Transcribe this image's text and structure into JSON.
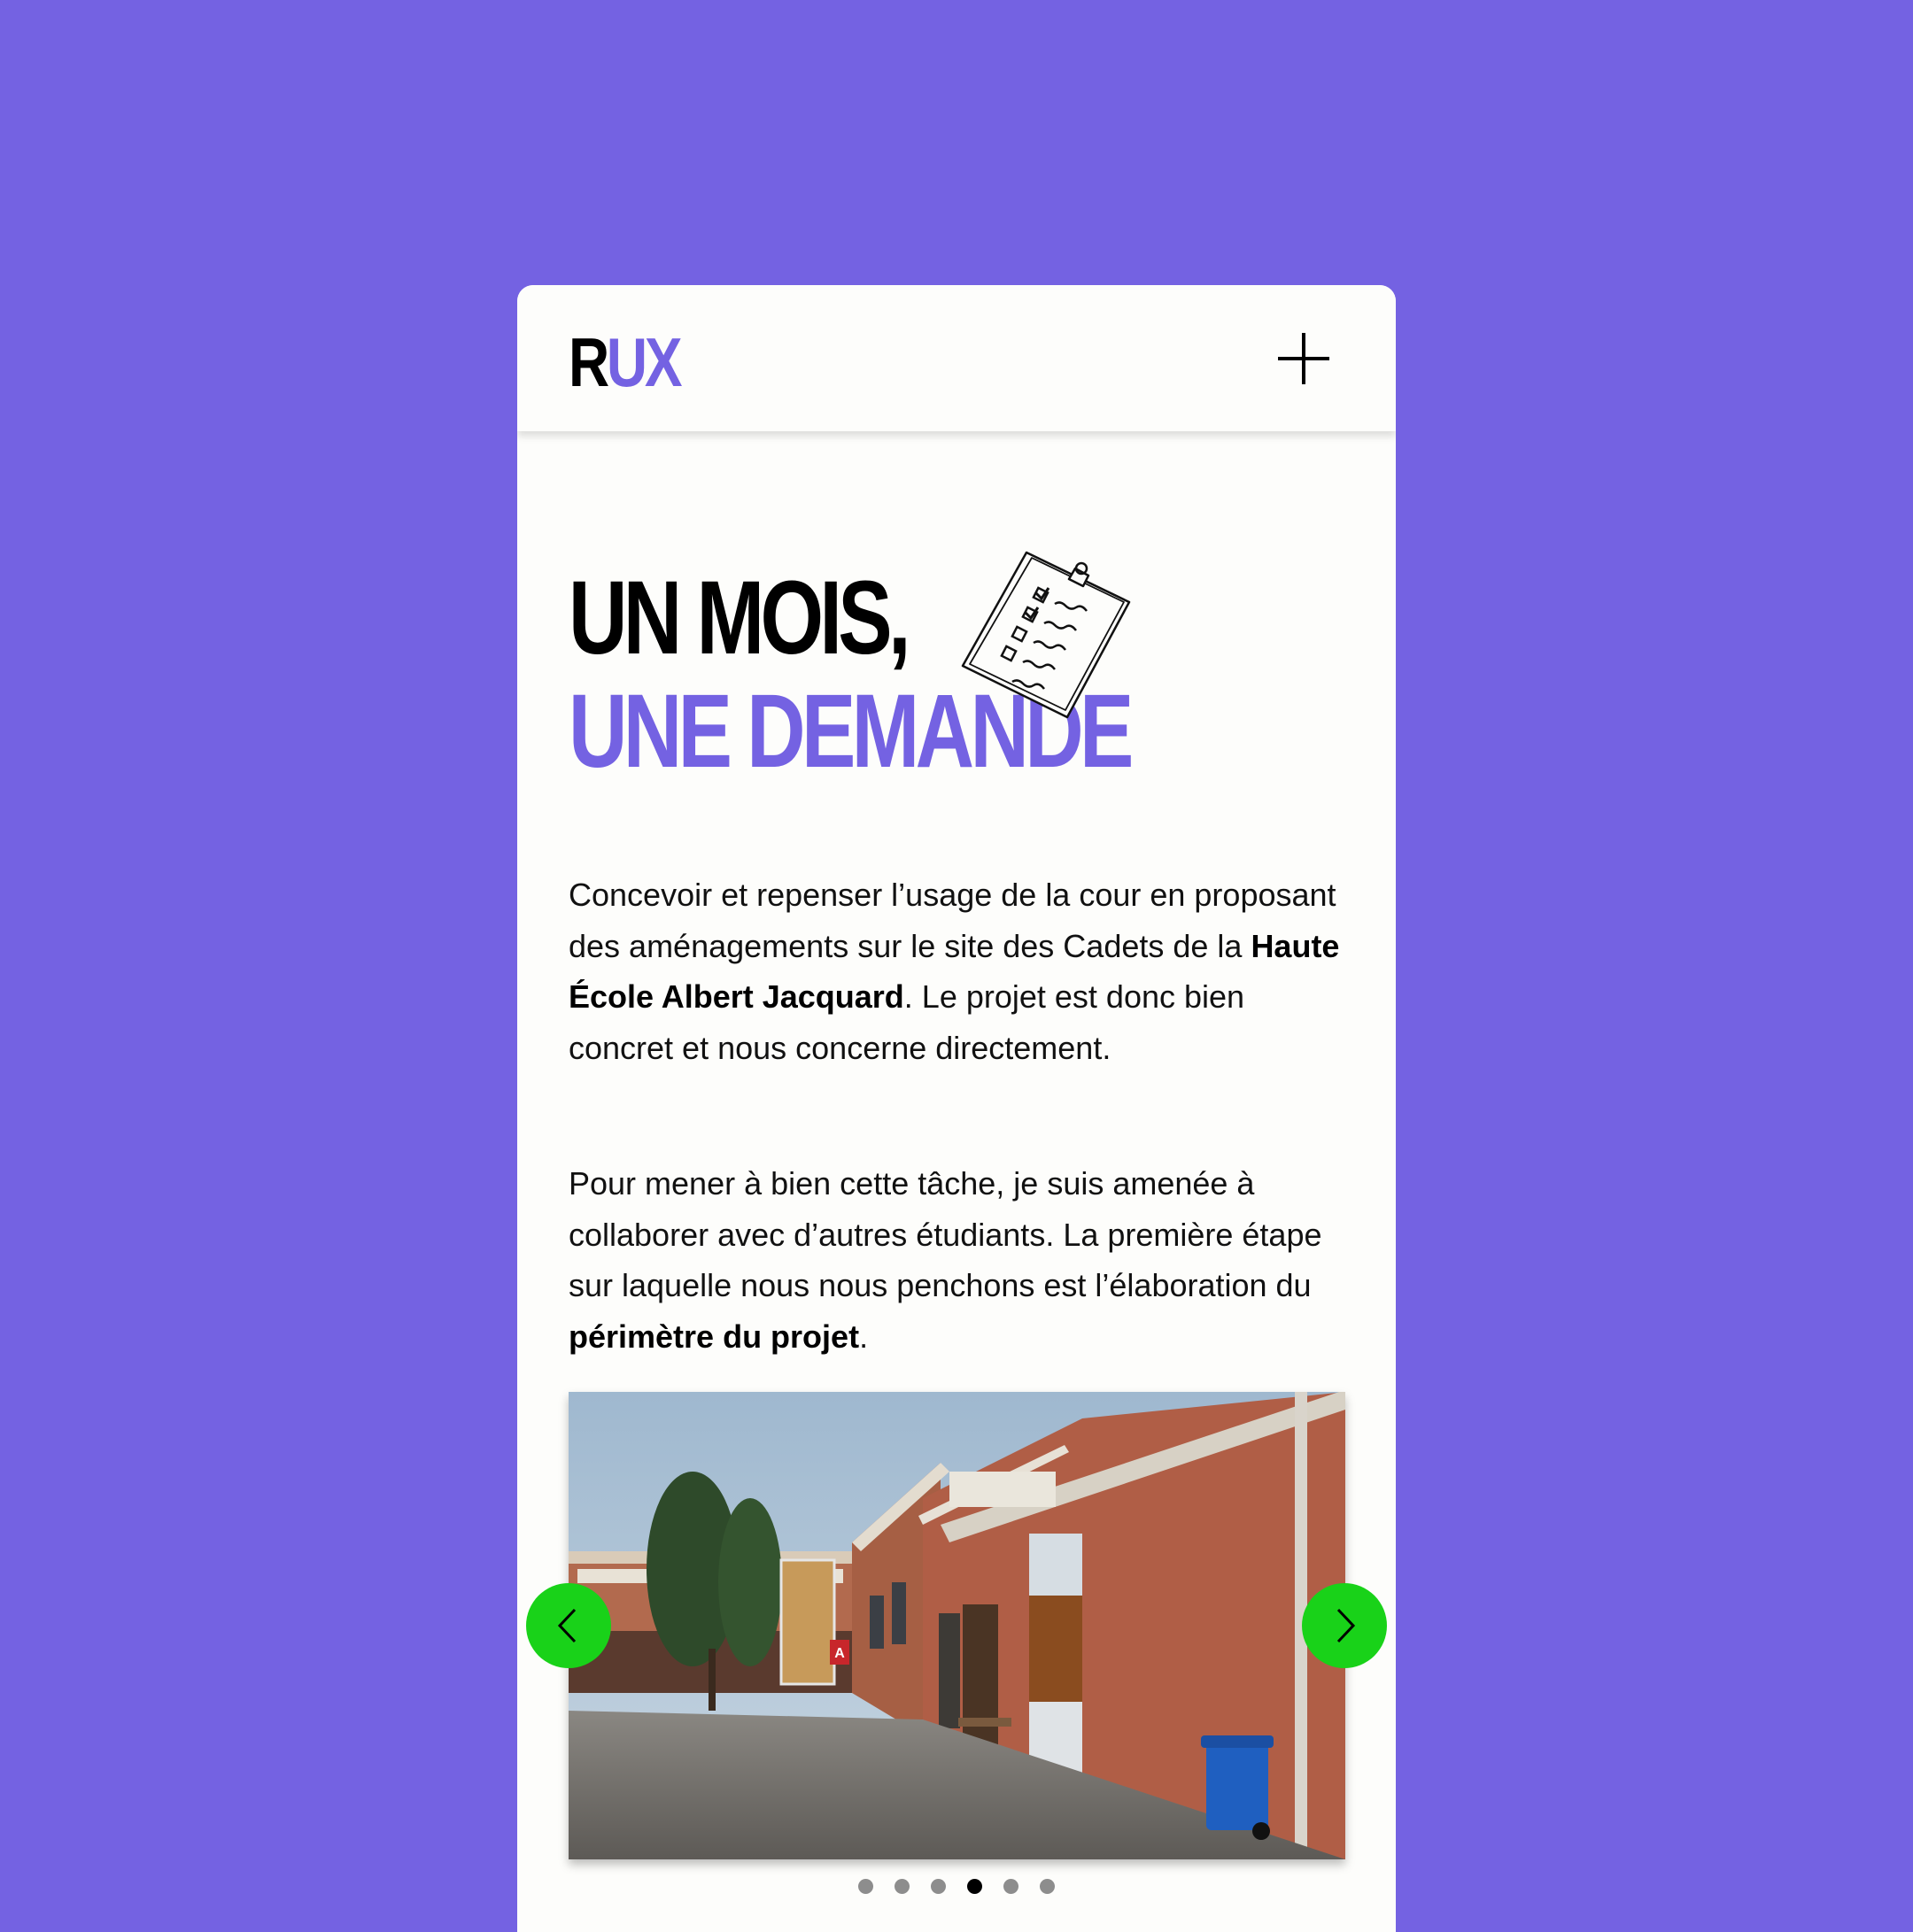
{
  "colors": {
    "background": "#7462e2",
    "accent": "#7462e2",
    "card": "#fdfdfb",
    "nav_button": "#19d219",
    "text": "#111111"
  },
  "header": {
    "logo_part1": "R",
    "logo_part2": "UX",
    "menu_icon": "plus-icon"
  },
  "hero": {
    "title_line1": "UN MOIS,",
    "title_line2": "UNE DEMANDE",
    "illustration": "clipboard-checklist-icon"
  },
  "paragraph1": {
    "text_before": "Concevoir et repenser l’usage de la cour en proposant des aménagements sur le site des Cadets de la ",
    "bold": "Haute École Albert Jacquard",
    "text_after": ". Le projet est donc bien concret et nous concerne directement."
  },
  "paragraph2": {
    "text_before": "Pour mener à bien cette tâche, je suis amenée à collaborer avec d’autres étudiants. La première étape sur laquelle nous nous penchons est l’élaboration du ",
    "bold": "périmètre du projet",
    "text_after": "."
  },
  "carousel": {
    "current_slide": 4,
    "total_slides": 6,
    "prev_icon": "chevron-left-icon",
    "next_icon": "chevron-right-icon",
    "building_sign": "A"
  }
}
